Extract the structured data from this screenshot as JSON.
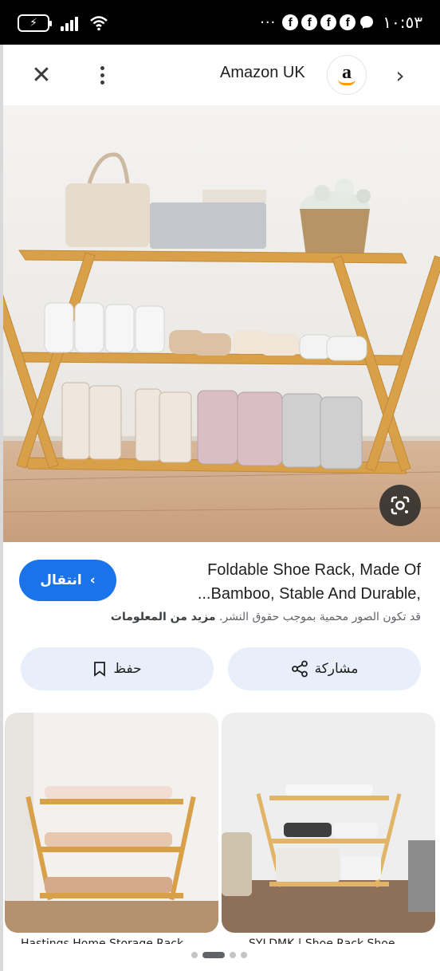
{
  "status_bar": {
    "time": "١٠:٥٣",
    "battery_icon": "battery-charging-icon",
    "notification_more": "···",
    "fb_letters": [
      "f",
      "f",
      "f",
      "f"
    ]
  },
  "header": {
    "site_name": "Amazon UK",
    "logo_letter": "a",
    "close_symbol": "✕",
    "chevron_symbol": "›"
  },
  "result": {
    "title_line1": "Foldable Shoe Rack, Made Of",
    "title_line2": "...Bamboo, Stable And Durable,",
    "visit_label": "انتقال",
    "visit_chevron": "‹",
    "copyright_text": "قد تكون الصور محمية بموجب حقوق النشر.",
    "learn_more": "مزيد من المعلومات"
  },
  "actions": {
    "share_label": "مشاركة",
    "save_label": "حفظ"
  },
  "related": [
    {
      "caption": "Hastings Home Storage Rack..."
    },
    {
      "caption": "SYLDMK | Shoe Rack Shoe..."
    }
  ],
  "colors": {
    "accent": "#1a73e8",
    "action_bg": "#e8effa",
    "bamboo": "#d9a04a"
  }
}
